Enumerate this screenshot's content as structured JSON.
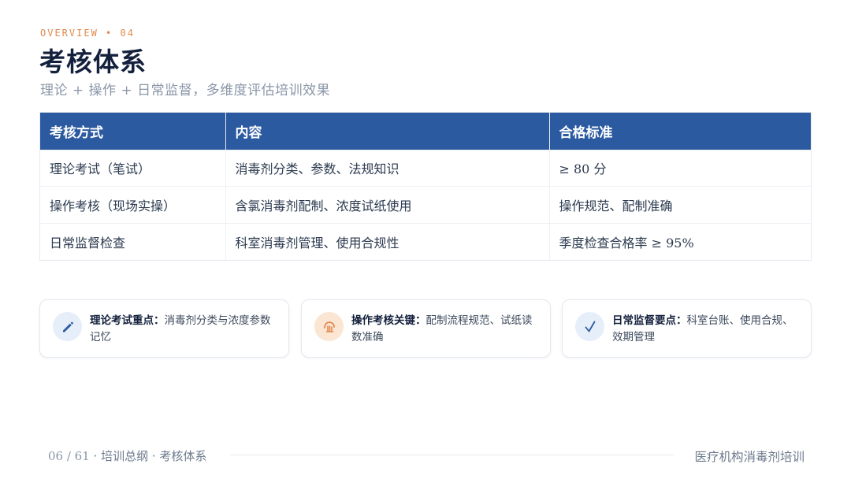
{
  "header": {
    "eyebrow": "OVERVIEW • 04",
    "title": "考核体系",
    "subtitle": "理论 + 操作 + 日常监督，多维度评估培训效果"
  },
  "table": {
    "headers": [
      "考核方式",
      "内容",
      "合格标准"
    ],
    "rows": [
      [
        "理论考试（笔试）",
        "消毒剂分类、参数、法规知识",
        "≥ 80 分"
      ],
      [
        "操作考核（现场实操）",
        "含氯消毒剂配制、浓度试纸使用",
        "操作规范、配制准确"
      ],
      [
        "日常监督检查",
        "科室消毒剂管理、使用合规性",
        "季度检查合格率 ≥ 95%"
      ]
    ]
  },
  "cards": [
    {
      "icon": "pencil-icon",
      "label": "理论考试重点：",
      "text": "消毒剂分类与浓度参数记忆",
      "accent": "#2c5aa0"
    },
    {
      "icon": "hand-icon",
      "label": "操作考核关键：",
      "text": "配制流程规范、试纸读数准确",
      "accent": "#e08a4e"
    },
    {
      "icon": "check-icon",
      "label": "日常监督要点：",
      "text": "科室台账、使用合规、效期管理",
      "accent": "#2c5aa0"
    }
  ],
  "footer": {
    "page": "06 / 61",
    "section": "· 培训总纲 · 考核体系",
    "brand": "医疗机构消毒剂培训"
  }
}
